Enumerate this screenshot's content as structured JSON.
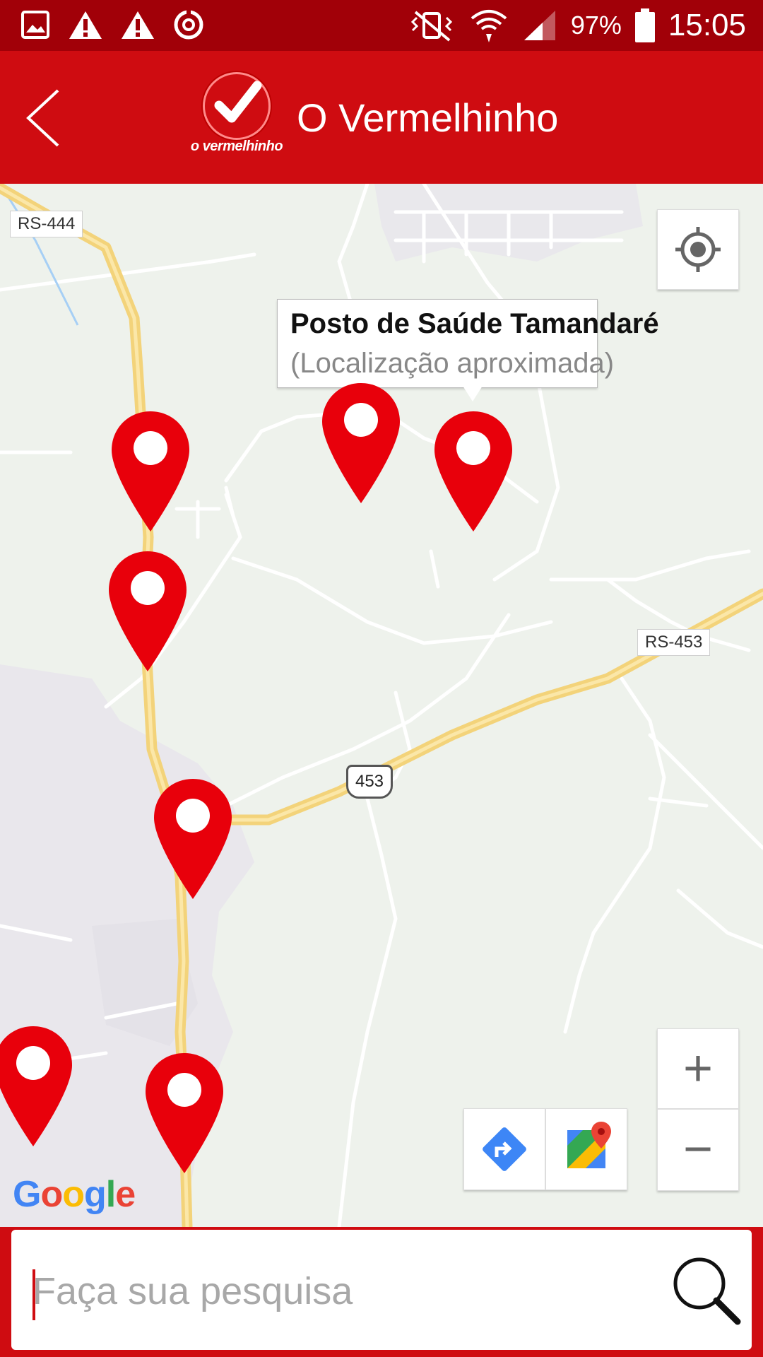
{
  "status_bar": {
    "battery_percent": "97%",
    "time": "15:05",
    "icons_left": [
      "gallery-icon",
      "warning-icon",
      "warning-icon",
      "sync-icon"
    ],
    "icons_right": [
      "vibrate-icon",
      "wifi-icon",
      "signal-icon",
      "battery-icon"
    ]
  },
  "header": {
    "back_icon": "chevron-left-icon",
    "logo_text": "o vermelhinho",
    "title": "O Vermelhinho"
  },
  "map": {
    "road_labels": {
      "rs444": "RS-444",
      "rs453": "RS-453",
      "route_453": "453"
    },
    "info_window": {
      "title": "Posto de Saúde Tamandaré",
      "subtitle": "(Localização aproximada)"
    },
    "pin_count": 7,
    "pin_color": "#e8000b",
    "controls": {
      "my_location_icon": "crosshair-icon",
      "zoom_in": "+",
      "zoom_out": "−",
      "directions_icon": "directions-icon",
      "maps_icon": "google-maps-icon"
    },
    "attribution": "Google"
  },
  "search": {
    "placeholder": "Faça sua pesquisa",
    "value": "",
    "icon": "search-icon"
  },
  "colors": {
    "status_bar": "#a10008",
    "app_bar": "#cf0c11",
    "pin": "#e8000b"
  }
}
